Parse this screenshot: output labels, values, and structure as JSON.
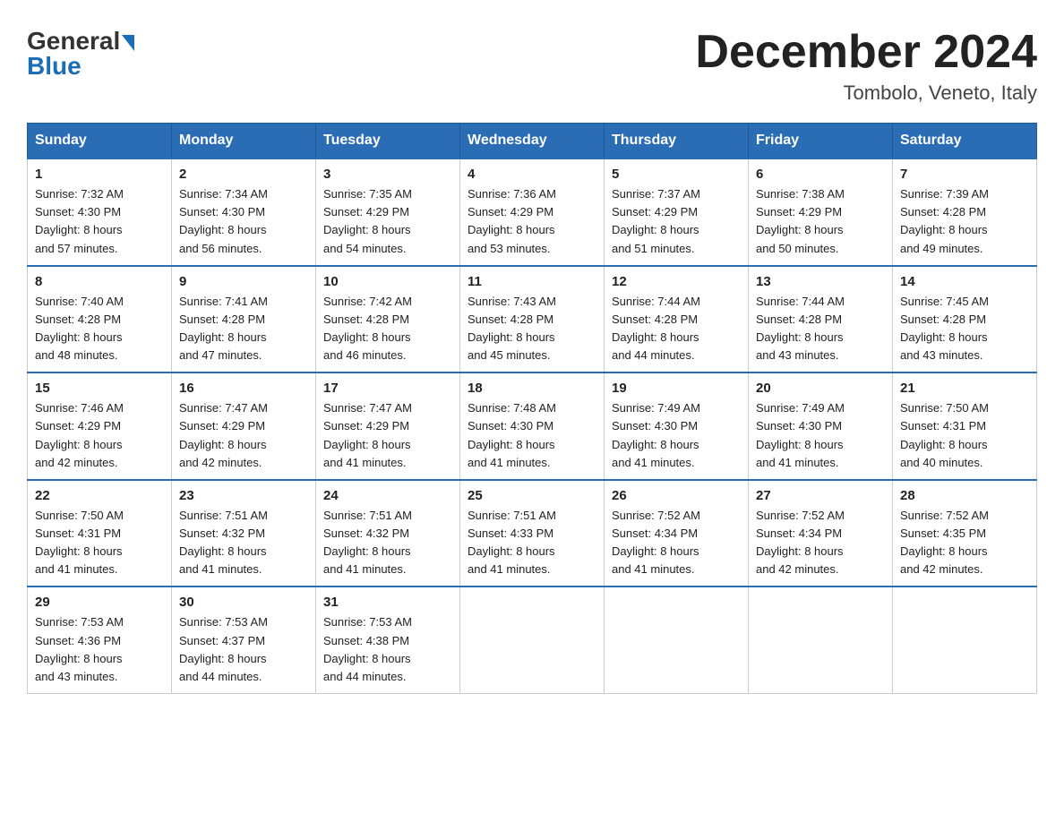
{
  "logo": {
    "general": "General",
    "blue": "Blue"
  },
  "title": "December 2024",
  "location": "Tombolo, Veneto, Italy",
  "days_of_week": [
    "Sunday",
    "Monday",
    "Tuesday",
    "Wednesday",
    "Thursday",
    "Friday",
    "Saturday"
  ],
  "weeks": [
    [
      {
        "day": "1",
        "sunrise": "7:32 AM",
        "sunset": "4:30 PM",
        "daylight": "8 hours and 57 minutes."
      },
      {
        "day": "2",
        "sunrise": "7:34 AM",
        "sunset": "4:30 PM",
        "daylight": "8 hours and 56 minutes."
      },
      {
        "day": "3",
        "sunrise": "7:35 AM",
        "sunset": "4:29 PM",
        "daylight": "8 hours and 54 minutes."
      },
      {
        "day": "4",
        "sunrise": "7:36 AM",
        "sunset": "4:29 PM",
        "daylight": "8 hours and 53 minutes."
      },
      {
        "day": "5",
        "sunrise": "7:37 AM",
        "sunset": "4:29 PM",
        "daylight": "8 hours and 51 minutes."
      },
      {
        "day": "6",
        "sunrise": "7:38 AM",
        "sunset": "4:29 PM",
        "daylight": "8 hours and 50 minutes."
      },
      {
        "day": "7",
        "sunrise": "7:39 AM",
        "sunset": "4:28 PM",
        "daylight": "8 hours and 49 minutes."
      }
    ],
    [
      {
        "day": "8",
        "sunrise": "7:40 AM",
        "sunset": "4:28 PM",
        "daylight": "8 hours and 48 minutes."
      },
      {
        "day": "9",
        "sunrise": "7:41 AM",
        "sunset": "4:28 PM",
        "daylight": "8 hours and 47 minutes."
      },
      {
        "day": "10",
        "sunrise": "7:42 AM",
        "sunset": "4:28 PM",
        "daylight": "8 hours and 46 minutes."
      },
      {
        "day": "11",
        "sunrise": "7:43 AM",
        "sunset": "4:28 PM",
        "daylight": "8 hours and 45 minutes."
      },
      {
        "day": "12",
        "sunrise": "7:44 AM",
        "sunset": "4:28 PM",
        "daylight": "8 hours and 44 minutes."
      },
      {
        "day": "13",
        "sunrise": "7:44 AM",
        "sunset": "4:28 PM",
        "daylight": "8 hours and 43 minutes."
      },
      {
        "day": "14",
        "sunrise": "7:45 AM",
        "sunset": "4:28 PM",
        "daylight": "8 hours and 43 minutes."
      }
    ],
    [
      {
        "day": "15",
        "sunrise": "7:46 AM",
        "sunset": "4:29 PM",
        "daylight": "8 hours and 42 minutes."
      },
      {
        "day": "16",
        "sunrise": "7:47 AM",
        "sunset": "4:29 PM",
        "daylight": "8 hours and 42 minutes."
      },
      {
        "day": "17",
        "sunrise": "7:47 AM",
        "sunset": "4:29 PM",
        "daylight": "8 hours and 41 minutes."
      },
      {
        "day": "18",
        "sunrise": "7:48 AM",
        "sunset": "4:30 PM",
        "daylight": "8 hours and 41 minutes."
      },
      {
        "day": "19",
        "sunrise": "7:49 AM",
        "sunset": "4:30 PM",
        "daylight": "8 hours and 41 minutes."
      },
      {
        "day": "20",
        "sunrise": "7:49 AM",
        "sunset": "4:30 PM",
        "daylight": "8 hours and 41 minutes."
      },
      {
        "day": "21",
        "sunrise": "7:50 AM",
        "sunset": "4:31 PM",
        "daylight": "8 hours and 40 minutes."
      }
    ],
    [
      {
        "day": "22",
        "sunrise": "7:50 AM",
        "sunset": "4:31 PM",
        "daylight": "8 hours and 41 minutes."
      },
      {
        "day": "23",
        "sunrise": "7:51 AM",
        "sunset": "4:32 PM",
        "daylight": "8 hours and 41 minutes."
      },
      {
        "day": "24",
        "sunrise": "7:51 AM",
        "sunset": "4:32 PM",
        "daylight": "8 hours and 41 minutes."
      },
      {
        "day": "25",
        "sunrise": "7:51 AM",
        "sunset": "4:33 PM",
        "daylight": "8 hours and 41 minutes."
      },
      {
        "day": "26",
        "sunrise": "7:52 AM",
        "sunset": "4:34 PM",
        "daylight": "8 hours and 41 minutes."
      },
      {
        "day": "27",
        "sunrise": "7:52 AM",
        "sunset": "4:34 PM",
        "daylight": "8 hours and 42 minutes."
      },
      {
        "day": "28",
        "sunrise": "7:52 AM",
        "sunset": "4:35 PM",
        "daylight": "8 hours and 42 minutes."
      }
    ],
    [
      {
        "day": "29",
        "sunrise": "7:53 AM",
        "sunset": "4:36 PM",
        "daylight": "8 hours and 43 minutes."
      },
      {
        "day": "30",
        "sunrise": "7:53 AM",
        "sunset": "4:37 PM",
        "daylight": "8 hours and 44 minutes."
      },
      {
        "day": "31",
        "sunrise": "7:53 AM",
        "sunset": "4:38 PM",
        "daylight": "8 hours and 44 minutes."
      },
      null,
      null,
      null,
      null
    ]
  ]
}
